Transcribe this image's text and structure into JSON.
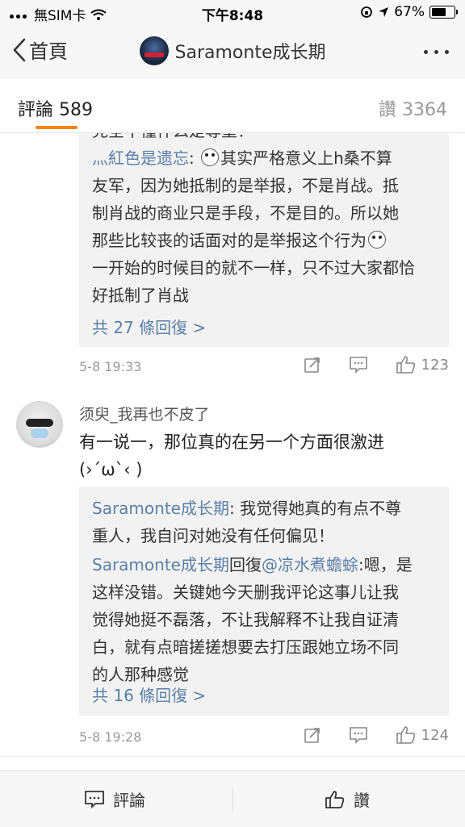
{
  "status_bar": {
    "carrier": "無SIM卡",
    "time": "下午8:48",
    "battery": "67%",
    "battery_level": 0.67
  },
  "nav": {
    "back_label": "首頁",
    "title": "Saramonte成长期"
  },
  "tabs": {
    "comments_label": "評論",
    "comments_count": "589",
    "likes_label": "讚",
    "likes_count": "3364"
  },
  "thread1": {
    "partial_line": "完全不懂什么是尊重！",
    "reply_author": "灬紅色是遗忘",
    "reply_lines": [
      "其实严格意义上h桑不算",
      "友军，因为她抵制的是举报，不是肖战。抵",
      "制肖战的商业只是手段，不是目的。所以她",
      "那些比较丧的话面对的是举报这个行为",
      "一开始的时候目的就不一样，只不过大家都恰",
      "好抵制了肖战"
    ],
    "more_replies": "共 27 條回復 >",
    "timestamp": "5-8 19:33",
    "like_count": "123"
  },
  "comment2": {
    "username": "须臾_我再也不皮了",
    "text_lines": [
      "有一说一，那位真的在另一个方面很激进",
      "(›´ω`‹ )"
    ],
    "reply1_author": "Saramonte成长期",
    "reply1_lines": [
      "我觉得她真的有点不尊",
      "重人，我自问对她没有任何偏见！"
    ],
    "reply2_author": "Saramonte成长期",
    "reply2_reply_word": "回復",
    "reply2_target": "@凉水煮蟾蜍",
    "reply2_lines": [
      ":嗯，是",
      "这样没错。关键她今天删我评论这事儿让我",
      "觉得她挺不磊落，不让我解释不让我自证清",
      "白，就有点暗搓搓想要去打压跟她立场不同",
      "的人那种感觉"
    ],
    "more_replies": "共 16 條回復 >",
    "timestamp": "5-8 19:28",
    "like_count": "124"
  },
  "bottom_bar": {
    "comment_label": "評論",
    "like_label": "讚"
  }
}
